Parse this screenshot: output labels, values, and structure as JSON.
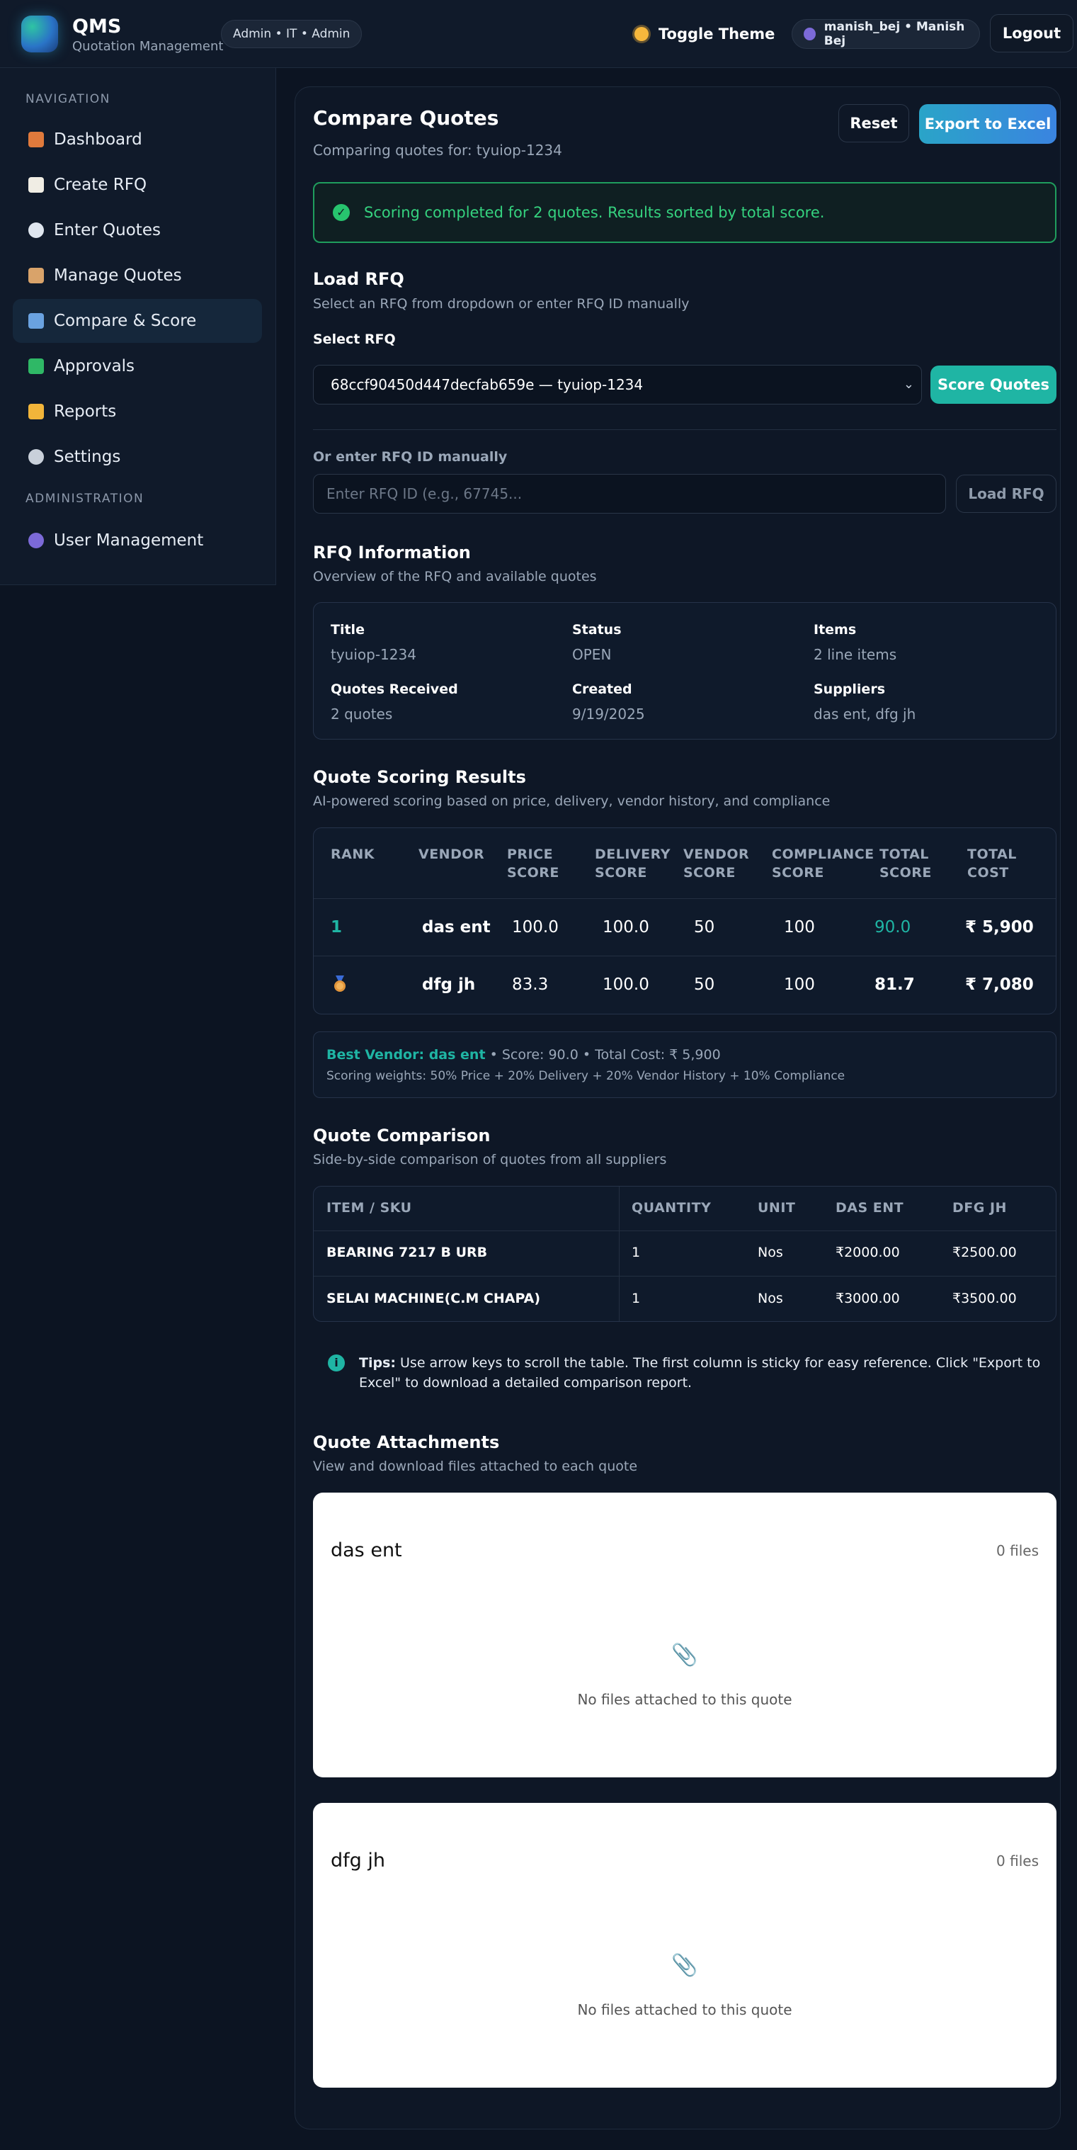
{
  "header": {
    "brand": "QMS",
    "brand_sub": "Quotation Management",
    "role": "Admin • IT • Admin",
    "toggle_theme": "Toggle Theme",
    "user": "manish_bej • Manish Bej",
    "logout": "Logout"
  },
  "sidebar": {
    "nav_heading": "NAVIGATION",
    "admin_heading": "ADMINISTRATION",
    "items": [
      {
        "label": "Dashboard",
        "icon": "house-icon",
        "color": "#e07a3c"
      },
      {
        "label": "Create RFQ",
        "icon": "page-icon",
        "color": "#f0ede4"
      },
      {
        "label": "Enter Quotes",
        "icon": "speech-bubble-icon",
        "color": "#dfe6ef"
      },
      {
        "label": "Manage Quotes",
        "icon": "clipboard-icon",
        "color": "#d9a36a"
      },
      {
        "label": "Compare & Score",
        "icon": "bar-chart-icon",
        "color": "#6aa2e0",
        "active": true
      },
      {
        "label": "Approvals",
        "icon": "check-box-icon",
        "color": "#2fb866"
      },
      {
        "label": "Reports",
        "icon": "folder-icon",
        "color": "#f2b53a"
      },
      {
        "label": "Settings",
        "icon": "gear-icon",
        "color": "#c9d0da"
      }
    ],
    "admin_items": [
      {
        "label": "User Management",
        "icon": "users-icon",
        "color": "#7c6ad8"
      }
    ]
  },
  "main": {
    "title": "Compare Quotes",
    "subtitle": "Comparing quotes for: tyuiop-1234",
    "reset": "Reset",
    "export": "Export to Excel",
    "alert": "Scoring completed for 2 quotes. Results sorted by total score.",
    "load_rfq": {
      "title": "Load RFQ",
      "subtitle": "Select an RFQ from dropdown or enter RFQ ID manually",
      "select_label": "Select RFQ",
      "selected": "68ccf90450d447decfab659e — tyuiop-1234",
      "score_button": "Score Quotes",
      "manual_label": "Or enter RFQ ID manually",
      "manual_placeholder": "Enter RFQ ID (e.g., 67745...",
      "load_button": "Load RFQ"
    },
    "rfq_info": {
      "title": "RFQ Information",
      "subtitle": "Overview of the RFQ and available quotes",
      "fields": [
        {
          "label": "Title",
          "value": "tyuiop-1234"
        },
        {
          "label": "Status",
          "value": "OPEN"
        },
        {
          "label": "Items",
          "value": "2 line items"
        },
        {
          "label": "Quotes Received",
          "value": "2 quotes"
        },
        {
          "label": "Created",
          "value": "9/19/2025"
        },
        {
          "label": "Suppliers",
          "value": "das ent, dfg jh"
        }
      ]
    },
    "scoring": {
      "title": "Quote Scoring Results",
      "subtitle": "AI-powered scoring based on price, delivery, vendor history, and compliance",
      "headers": [
        "RANK",
        "VENDOR",
        "PRICE SCORE",
        "DELIVERY SCORE",
        "VENDOR SCORE",
        "COMPLIANCE SCORE",
        "TOTAL SCORE",
        "TOTAL COST"
      ],
      "rows": [
        {
          "rank": "1",
          "vendor": "das ent",
          "price": "100.0",
          "delivery": "100.0",
          "vendor_score": "50",
          "compliance": "100",
          "total": "90.0",
          "cost": "₹ 5,900"
        },
        {
          "rank": "medal",
          "vendor": "dfg jh",
          "price": "83.3",
          "delivery": "100.0",
          "vendor_score": "50",
          "compliance": "100",
          "total": "81.7",
          "cost": "₹ 7,080"
        }
      ],
      "best_label": "Best Vendor: das ent",
      "best_detail": " • Score: 90.0 • Total Cost: ₹ 5,900",
      "weights": "Scoring weights: 50% Price + 20% Delivery + 20% Vendor History + 10% Compliance"
    },
    "comparison": {
      "title": "Quote Comparison",
      "subtitle": "Side-by-side comparison of quotes from all suppliers",
      "headers": [
        "ITEM / SKU",
        "QUANTITY",
        "UNIT",
        "DAS ENT",
        "DFG JH"
      ],
      "rows": [
        [
          "BEARING 7217 B URB",
          "1",
          "Nos",
          "₹2000.00",
          "₹2500.00"
        ],
        [
          "SELAI MACHINE(C.M CHAPA)",
          "1",
          "Nos",
          "₹3000.00",
          "₹3500.00"
        ]
      ],
      "tips_bold": "Tips:",
      "tips_line1": " Use arrow keys to scroll the table. The first column is sticky for easy reference. Click \"Export to",
      "tips_line2": "Excel\" to download a detailed comparison report."
    },
    "attachments": {
      "title": "Quote Attachments",
      "subtitle": "View and download files attached to each quote",
      "cards": [
        {
          "vendor": "das ent",
          "count": "0 files",
          "empty": "No files attached to this quote"
        },
        {
          "vendor": "dfg jh",
          "count": "0 files",
          "empty": "No files attached to this quote"
        }
      ]
    }
  }
}
